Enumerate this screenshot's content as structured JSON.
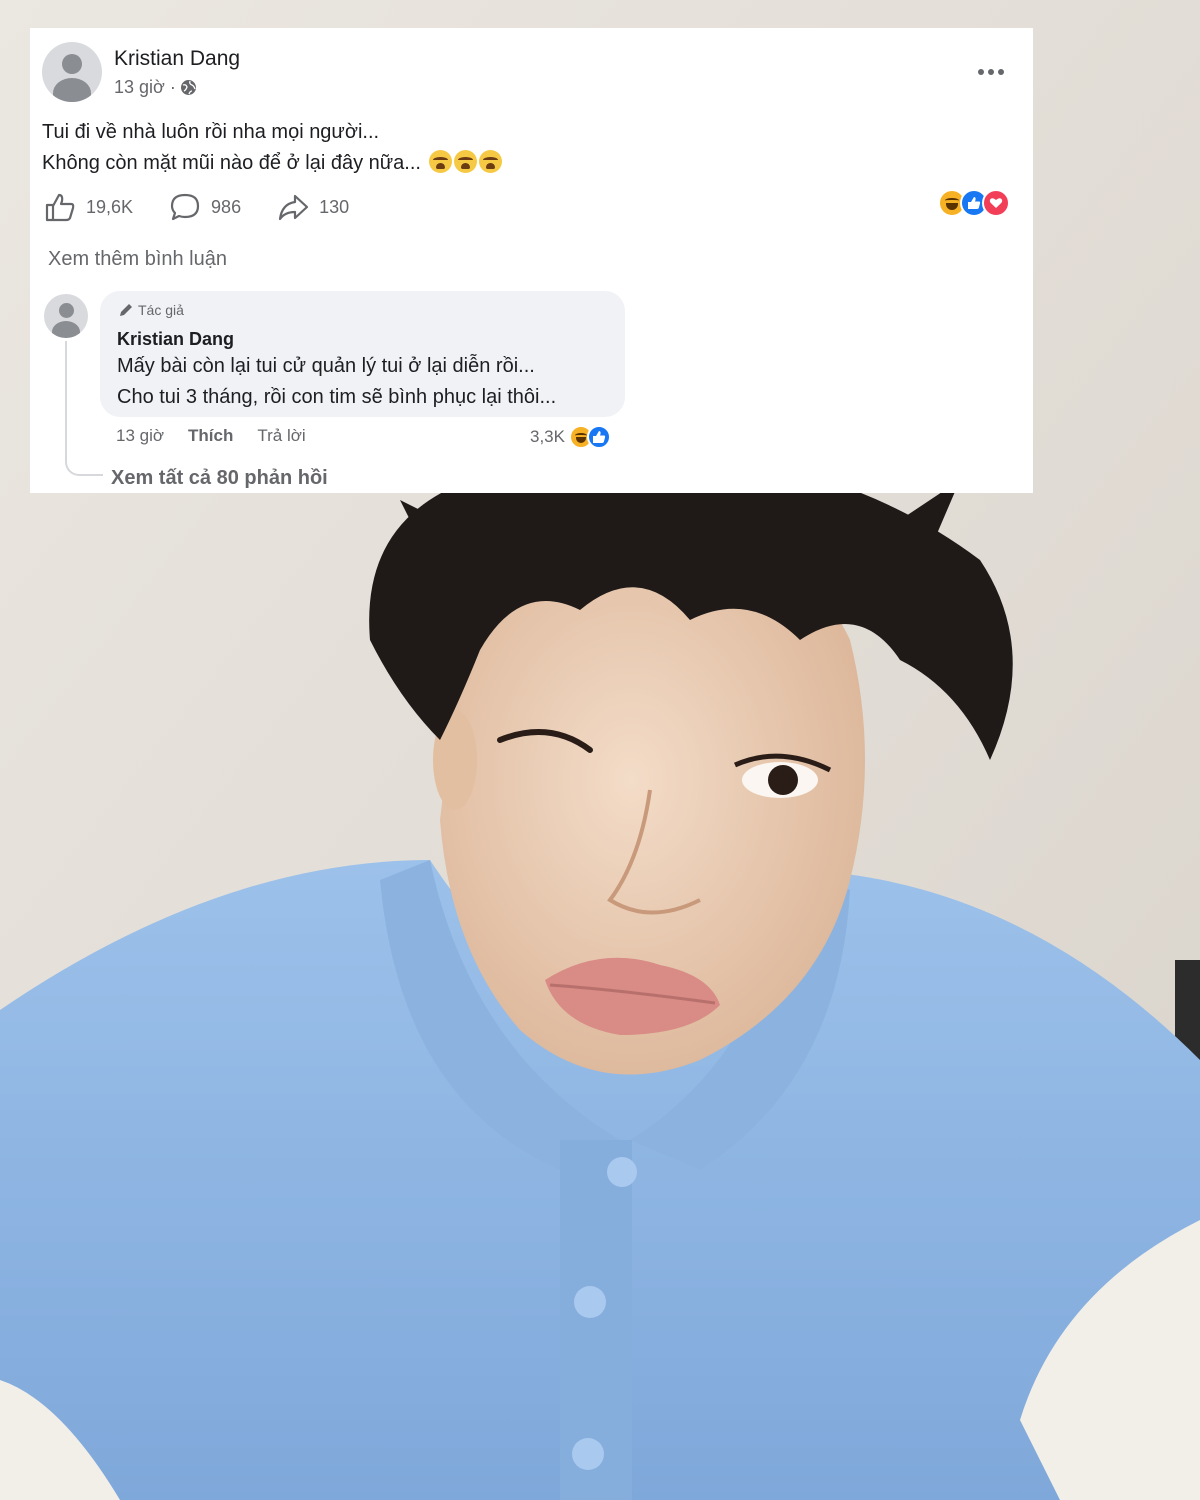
{
  "post": {
    "author": "Kristian Dang",
    "time": "13 giờ ·",
    "lines": [
      "Tui đi về nhà luôn rồi nha mọi người...",
      "Không còn mặt mũi nào để ở lại đây nữa..."
    ],
    "likes": "19,6K",
    "comments": "986",
    "shares": "130",
    "view_more_comments": "Xem thêm bình luận"
  },
  "comment": {
    "badge": "Tác giả",
    "author": "Kristian Dang",
    "lines": [
      "Mấy bài còn lại tui cử quản lý tui ở lại diễn rồi...",
      "Cho tui 3 tháng, rồi con tim sẽ bình phục lại thôi..."
    ],
    "time": "13 giờ",
    "like_label": "Thích",
    "reply_label": "Trả lời",
    "reaction_count": "3,3K",
    "view_replies": "Xem tất cả 80 phản hồi"
  },
  "colors": {
    "like_blue": "#1877f2",
    "love_red": "#f33e58",
    "haha_yellow": "#f7b125",
    "secondary_text": "#65676b",
    "shirt_blue": "#8fb6e3"
  },
  "icons": [
    "globe-icon",
    "more-icon",
    "like-icon",
    "comment-icon",
    "share-icon",
    "pencil-icon",
    "crying-emoji-icon"
  ]
}
